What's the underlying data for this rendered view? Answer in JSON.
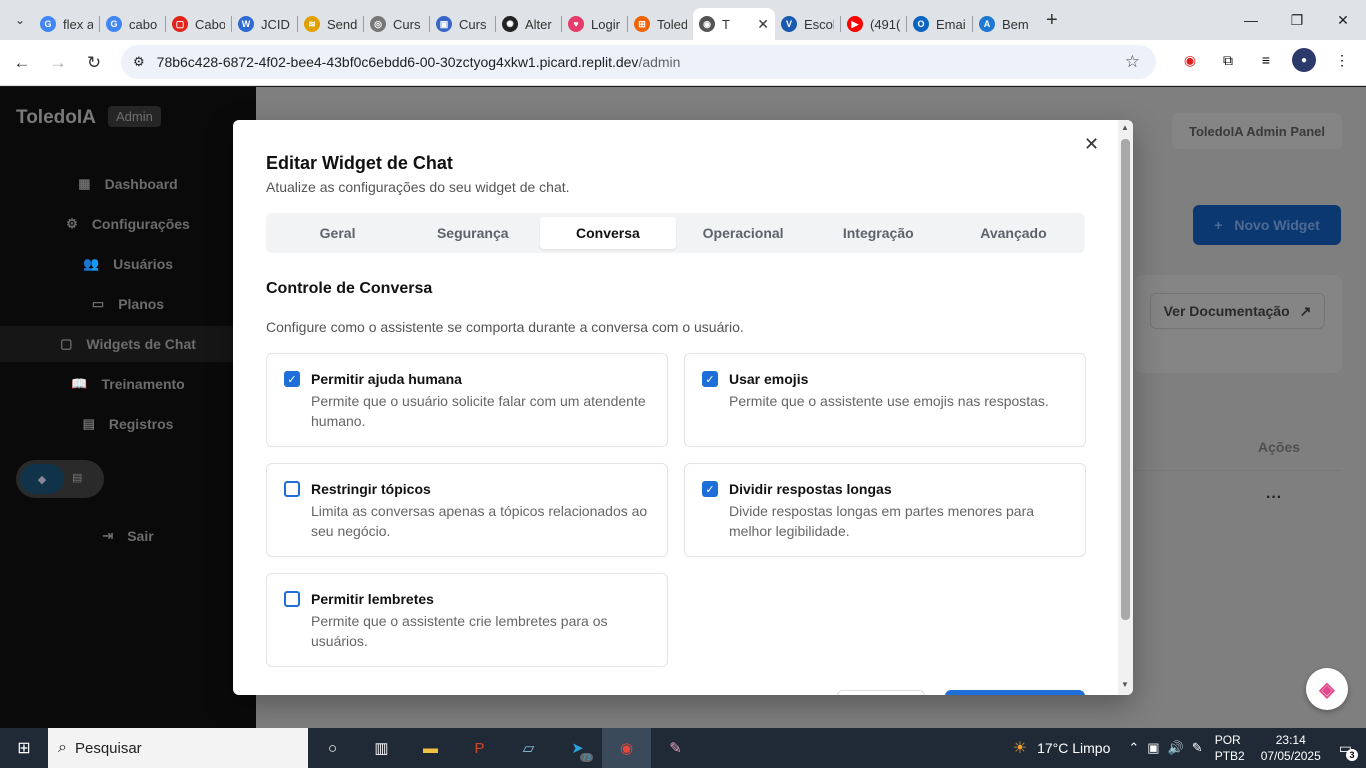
{
  "browser": {
    "tabs": [
      {
        "label": "flex a",
        "icon": "google-icon",
        "color": "#4285f4",
        "glyph": "G"
      },
      {
        "label": "cabo",
        "icon": "google-icon",
        "color": "#4285f4",
        "glyph": "G"
      },
      {
        "label": "Cabo",
        "icon": "brand-red-icon",
        "color": "#e1251b",
        "glyph": "▢"
      },
      {
        "label": "JCID",
        "icon": "jcid-icon",
        "color": "#2f6ad4",
        "glyph": "W"
      },
      {
        "label": "Send",
        "icon": "send-icon",
        "color": "#e0a000",
        "glyph": "≋"
      },
      {
        "label": "Curs",
        "icon": "globe-icon",
        "color": "#777777",
        "glyph": "◎"
      },
      {
        "label": "Curs",
        "icon": "course-icon",
        "color": "#3a66c8",
        "glyph": "▣"
      },
      {
        "label": "Alter",
        "icon": "openai-icon",
        "color": "#222222",
        "glyph": "✺"
      },
      {
        "label": "Logir",
        "icon": "heart-icon",
        "color": "#e63c6b",
        "glyph": "♥"
      },
      {
        "label": "Toled",
        "icon": "replit-icon",
        "color": "#f26207",
        "glyph": "⊞"
      },
      {
        "label": "T",
        "icon": "globe-icon",
        "color": "#555555",
        "glyph": "◉",
        "active": true
      },
      {
        "label": "Escol",
        "icon": "vt-icon",
        "color": "#1a5bb0",
        "glyph": "V"
      },
      {
        "label": "(491(",
        "icon": "youtube-icon",
        "color": "#ff0000",
        "glyph": "▶"
      },
      {
        "label": "Emai",
        "icon": "outlook-icon",
        "color": "#0a64c2",
        "glyph": "O"
      },
      {
        "label": "Bem",
        "icon": "azure-icon",
        "color": "#1f78d1",
        "glyph": "A"
      }
    ],
    "url_host": "78b6c428-6872-4f02-bee4-43bf0c6ebdd6-00-30zctyog4xkw1.picard.replit.dev",
    "url_path": "/admin"
  },
  "sidebar": {
    "brand": "ToledoIA",
    "badge": "Admin",
    "items": [
      {
        "label": "Dashboard",
        "icon": "grid-icon",
        "glyph": "▦"
      },
      {
        "label": "Configurações",
        "icon": "gear-icon",
        "glyph": "⚙"
      },
      {
        "label": "Usuários",
        "icon": "users-icon",
        "glyph": "👥"
      },
      {
        "label": "Planos",
        "icon": "card-icon",
        "glyph": "▭"
      },
      {
        "label": "Widgets de Chat",
        "icon": "chat-icon",
        "glyph": "▢"
      },
      {
        "label": "Treinamento",
        "icon": "book-icon",
        "glyph": "📖"
      },
      {
        "label": "Registros",
        "icon": "file-icon",
        "glyph": "▤"
      }
    ],
    "logout": "Sair"
  },
  "main": {
    "panel_title": "ToledoIA Admin Panel",
    "new_widget": "Novo Widget",
    "docs_button": "Ver Documentação",
    "actions_header": "Ações"
  },
  "modal": {
    "title": "Editar Widget de Chat",
    "subtitle": "Atualize as configurações do seu widget de chat.",
    "tabs": [
      "Geral",
      "Segurança",
      "Conversa",
      "Operacional",
      "Integração",
      "Avançado"
    ],
    "active_tab": "Conversa",
    "section_title": "Controle de Conversa",
    "section_desc": "Configure como o assistente se comporta durante a conversa com o usuário.",
    "options": [
      {
        "title": "Permitir ajuda humana",
        "desc": "Permite que o usuário solicite falar com um atendente humano.",
        "checked": true
      },
      {
        "title": "Usar emojis",
        "desc": "Permite que o assistente use emojis nas respostas.",
        "checked": true
      },
      {
        "title": "Restringir tópicos",
        "desc": "Limita as conversas apenas a tópicos relacionados ao seu negócio.",
        "checked": false
      },
      {
        "title": "Dividir respostas longas",
        "desc": "Divide respostas longas em partes menores para melhor legibilidade.",
        "checked": true
      },
      {
        "title": "Permitir lembretes",
        "desc": "Permite que o assistente crie lembretes para os usuários.",
        "checked": false
      }
    ]
  },
  "taskbar": {
    "search_placeholder": "Pesquisar",
    "weather": "17°C  Limpo",
    "lang_line1": "POR",
    "lang_line2": "PTB2",
    "time": "23:14",
    "date": "07/05/2025",
    "notifications": "3",
    "telegram_badge": "73"
  },
  "colors": {
    "accent": "#1f6fd8",
    "sidebar_bg": "#0a0a0a"
  }
}
